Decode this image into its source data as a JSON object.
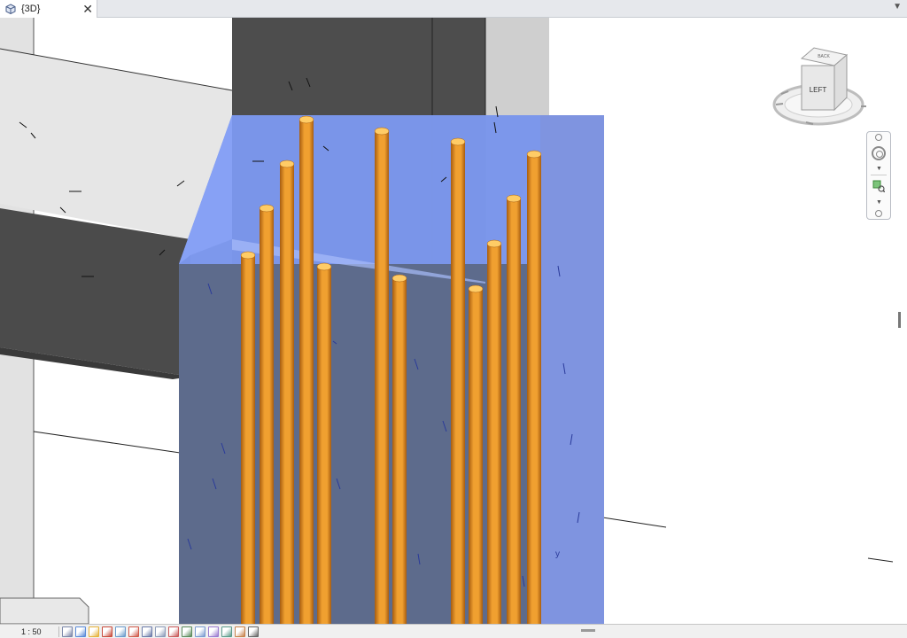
{
  "tabs": [
    {
      "label": "{3D}",
      "icon": "3d-view-icon",
      "active": true
    }
  ],
  "tab_close_glyph": "✕",
  "tab_menu_glyph": "▼",
  "viewcube": {
    "face_label": "LEFT",
    "side_label": "BACK"
  },
  "view_label_y": "y",
  "status": {
    "scale": "1 : 50"
  },
  "status_icons": [
    "detail-level-icon",
    "visual-style-icon",
    "sun-path-icon",
    "shadows-icon",
    "render-icon",
    "crop-view-icon",
    "show-crop-icon",
    "lock-3d-view-icon",
    "temporary-hide-icon",
    "reveal-hidden-icon",
    "worksharing-icon",
    "analytical-model-icon",
    "highlight-displacement-icon",
    "reveal-constraints-icon",
    "preview-visibility-icon"
  ],
  "colors": {
    "rebar": "#f0a030",
    "rebar_shade": "#a85d10",
    "rebar_top": "#ffcc66",
    "column_dark": "#4b4b4b",
    "concrete_light": "#e6e6e6",
    "selected_blue": "#5b7ff5",
    "selected_front": "#5d6b8c",
    "tab_bar": "#e6e8ec"
  }
}
